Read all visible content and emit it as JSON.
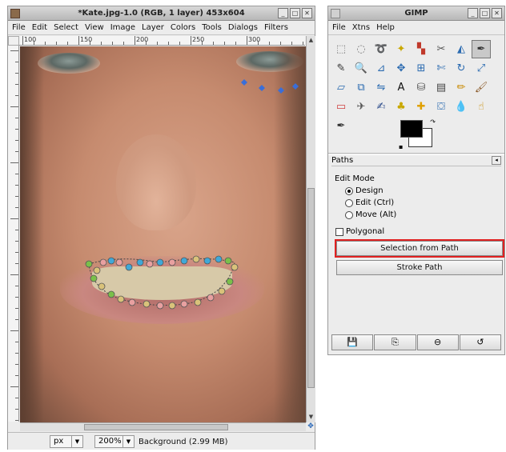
{
  "image_window": {
    "title": "*Kate.jpg-1.0 (RGB, 1 layer) 453x604",
    "menu": [
      "File",
      "Edit",
      "Select",
      "View",
      "Image",
      "Layer",
      "Colors",
      "Tools",
      "Dialogs",
      "Filters"
    ],
    "ruler_ticks": [
      "100",
      "150",
      "200",
      "250",
      "300"
    ],
    "unit": "px",
    "zoom": "200%",
    "status": "Background (2.99 MB)"
  },
  "toolbox_window": {
    "title": "GIMP",
    "menu": [
      "File",
      "Xtns",
      "Help"
    ],
    "tools": [
      {
        "name": "rect-select-icon",
        "glyph": "⬚",
        "color": "#777"
      },
      {
        "name": "ellipse-select-icon",
        "glyph": "◌",
        "color": "#777"
      },
      {
        "name": "free-select-icon",
        "glyph": "➰",
        "color": "#777"
      },
      {
        "name": "fuzzy-select-icon",
        "glyph": "✦",
        "color": "#c9a800"
      },
      {
        "name": "select-by-color-icon",
        "glyph": "▚",
        "color": "#c0392b"
      },
      {
        "name": "scissors-icon",
        "glyph": "✂",
        "color": "#555"
      },
      {
        "name": "foreground-select-icon",
        "glyph": "◭",
        "color": "#2a6ab0"
      },
      {
        "name": "paths-icon",
        "glyph": "✒",
        "color": "#333"
      },
      {
        "name": "color-picker-icon",
        "glyph": "✎",
        "color": "#333"
      },
      {
        "name": "magnify-icon",
        "glyph": "🔍",
        "color": "#2a6ab0"
      },
      {
        "name": "measure-icon",
        "glyph": "⊿",
        "color": "#2a6ab0"
      },
      {
        "name": "move-icon",
        "glyph": "✥",
        "color": "#2a6ab0"
      },
      {
        "name": "align-icon",
        "glyph": "⊞",
        "color": "#2a6ab0"
      },
      {
        "name": "crop-icon",
        "glyph": "✄",
        "color": "#2a6ab0"
      },
      {
        "name": "rotate-icon",
        "glyph": "↻",
        "color": "#2a6ab0"
      },
      {
        "name": "scale-icon",
        "glyph": "⤢",
        "color": "#2a6ab0"
      },
      {
        "name": "shear-icon",
        "glyph": "▱",
        "color": "#2a6ab0"
      },
      {
        "name": "perspective-icon",
        "glyph": "⧉",
        "color": "#2a6ab0"
      },
      {
        "name": "flip-icon",
        "glyph": "⇋",
        "color": "#2a6ab0"
      },
      {
        "name": "text-icon",
        "glyph": "A",
        "color": "#111"
      },
      {
        "name": "bucket-fill-icon",
        "glyph": "⛁",
        "color": "#555"
      },
      {
        "name": "blend-icon",
        "glyph": "▤",
        "color": "#444"
      },
      {
        "name": "pencil-icon",
        "glyph": "✏",
        "color": "#c98a00"
      },
      {
        "name": "paintbrush-icon",
        "glyph": "🖌",
        "color": "#8a5a2a"
      },
      {
        "name": "eraser-icon",
        "glyph": "▭",
        "color": "#d04040"
      },
      {
        "name": "airbrush-icon",
        "glyph": "✈",
        "color": "#555"
      },
      {
        "name": "ink-icon",
        "glyph": "✍",
        "color": "#2a4a8a"
      },
      {
        "name": "clone-icon",
        "glyph": "♣",
        "color": "#c9a800"
      },
      {
        "name": "heal-icon",
        "glyph": "✚",
        "color": "#e0a000"
      },
      {
        "name": "perspective-clone-icon",
        "glyph": "⛋",
        "color": "#2a6ab0"
      },
      {
        "name": "blur-icon",
        "glyph": "💧",
        "color": "#2a6ab0"
      },
      {
        "name": "smudge-icon",
        "glyph": "☝",
        "color": "#c98a00"
      },
      {
        "name": "dodge-burn-icon",
        "glyph": "✒",
        "color": "#333"
      }
    ],
    "active_tool": 7,
    "dock_tab": "Paths",
    "edit_mode_label": "Edit Mode",
    "modes": [
      "Design",
      "Edit (Ctrl)",
      "Move (Alt)"
    ],
    "selected_mode": 0,
    "polygonal_label": "Polygonal",
    "selection_from_path": "Selection from Path",
    "stroke_path": "Stroke Path",
    "bottom_buttons": [
      {
        "name": "save-options-icon",
        "glyph": "💾"
      },
      {
        "name": "restore-options-icon",
        "glyph": "⎘"
      },
      {
        "name": "delete-options-icon",
        "glyph": "⊖"
      },
      {
        "name": "reset-options-icon",
        "glyph": "↺"
      }
    ],
    "highlight_color": "#e02020"
  }
}
